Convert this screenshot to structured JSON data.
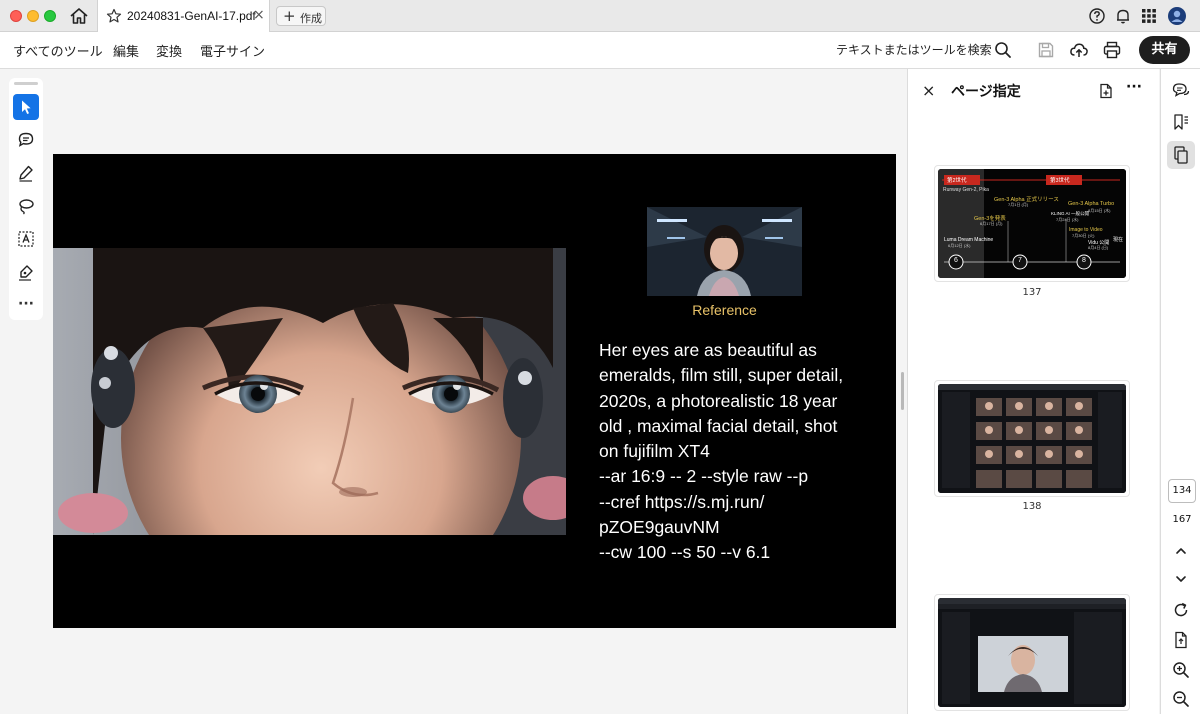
{
  "titlebar": {
    "tab_title": "20240831-GenAI-17.pdf",
    "tab_close": "×",
    "new_tab_label": "作成",
    "new_tab_plus": "+"
  },
  "menubar": {
    "items": [
      "すべてのツール",
      "編集",
      "変換",
      "電子サイン"
    ],
    "search_label": "テキストまたはツールを検索",
    "share_label": "共有"
  },
  "toolbar_left": {
    "tools": [
      "select-tool",
      "comment-tool",
      "pen-tool",
      "lasso-tool",
      "text-select-tool",
      "sign-tool"
    ],
    "more": "···"
  },
  "slide": {
    "reference_caption": "Reference",
    "prompt_lines": [
      "Her eyes are as beautiful as",
      "emeralds, film still, super detail,",
      "2020s, a photorealistic 18 year",
      "old , maximal facial detail, shot",
      "on fujifilm XT4",
      "--ar 16:9 -- 2 --style raw --p",
      "--cref https://s.mj.run/",
      "pZOE9gauvNM",
      "--cw 100 --s 50 --v 6.1"
    ]
  },
  "panel": {
    "close": "×",
    "title": "ページ指定",
    "more": "···",
    "thumbnails": [
      {
        "label": "137",
        "gen2": "第2世代",
        "gen3": "第3世代",
        "runway": "Runway Gen-2, Pika",
        "alpha": "Gen-3 Alpha 正式リリース",
        "alpha_date": "7月1日 (月)",
        "announce": "Gen-3を発表",
        "announce_date": "6月17日 (月)",
        "kling": "KLING AI 一般公開",
        "kling_date": "7月24日 (水)",
        "turbo": "Gen-3 Alpha Turbo",
        "turbo_date": "8月15日 (木)",
        "luma": "Luma Dream Machine",
        "luma_date": "6月12日 (水)",
        "i2v": "Image to Video",
        "i2v_date": "7月30日 (火)",
        "vidu": "Vidu 公開",
        "vidu_date": "8月4日 (日)",
        "now": "現在",
        "markers": [
          "6",
          "7",
          "8"
        ]
      },
      {
        "label": "138"
      },
      {
        "label": ""
      }
    ]
  },
  "rightrail": {
    "current_page": "134",
    "total_pages": "167"
  },
  "colors": {
    "accent": "#1473e6",
    "share_bg": "#1e1e1e",
    "caption": "#e8c268",
    "thumb_red": "#c8281e",
    "thumb_yellow": "#e6c84a"
  }
}
